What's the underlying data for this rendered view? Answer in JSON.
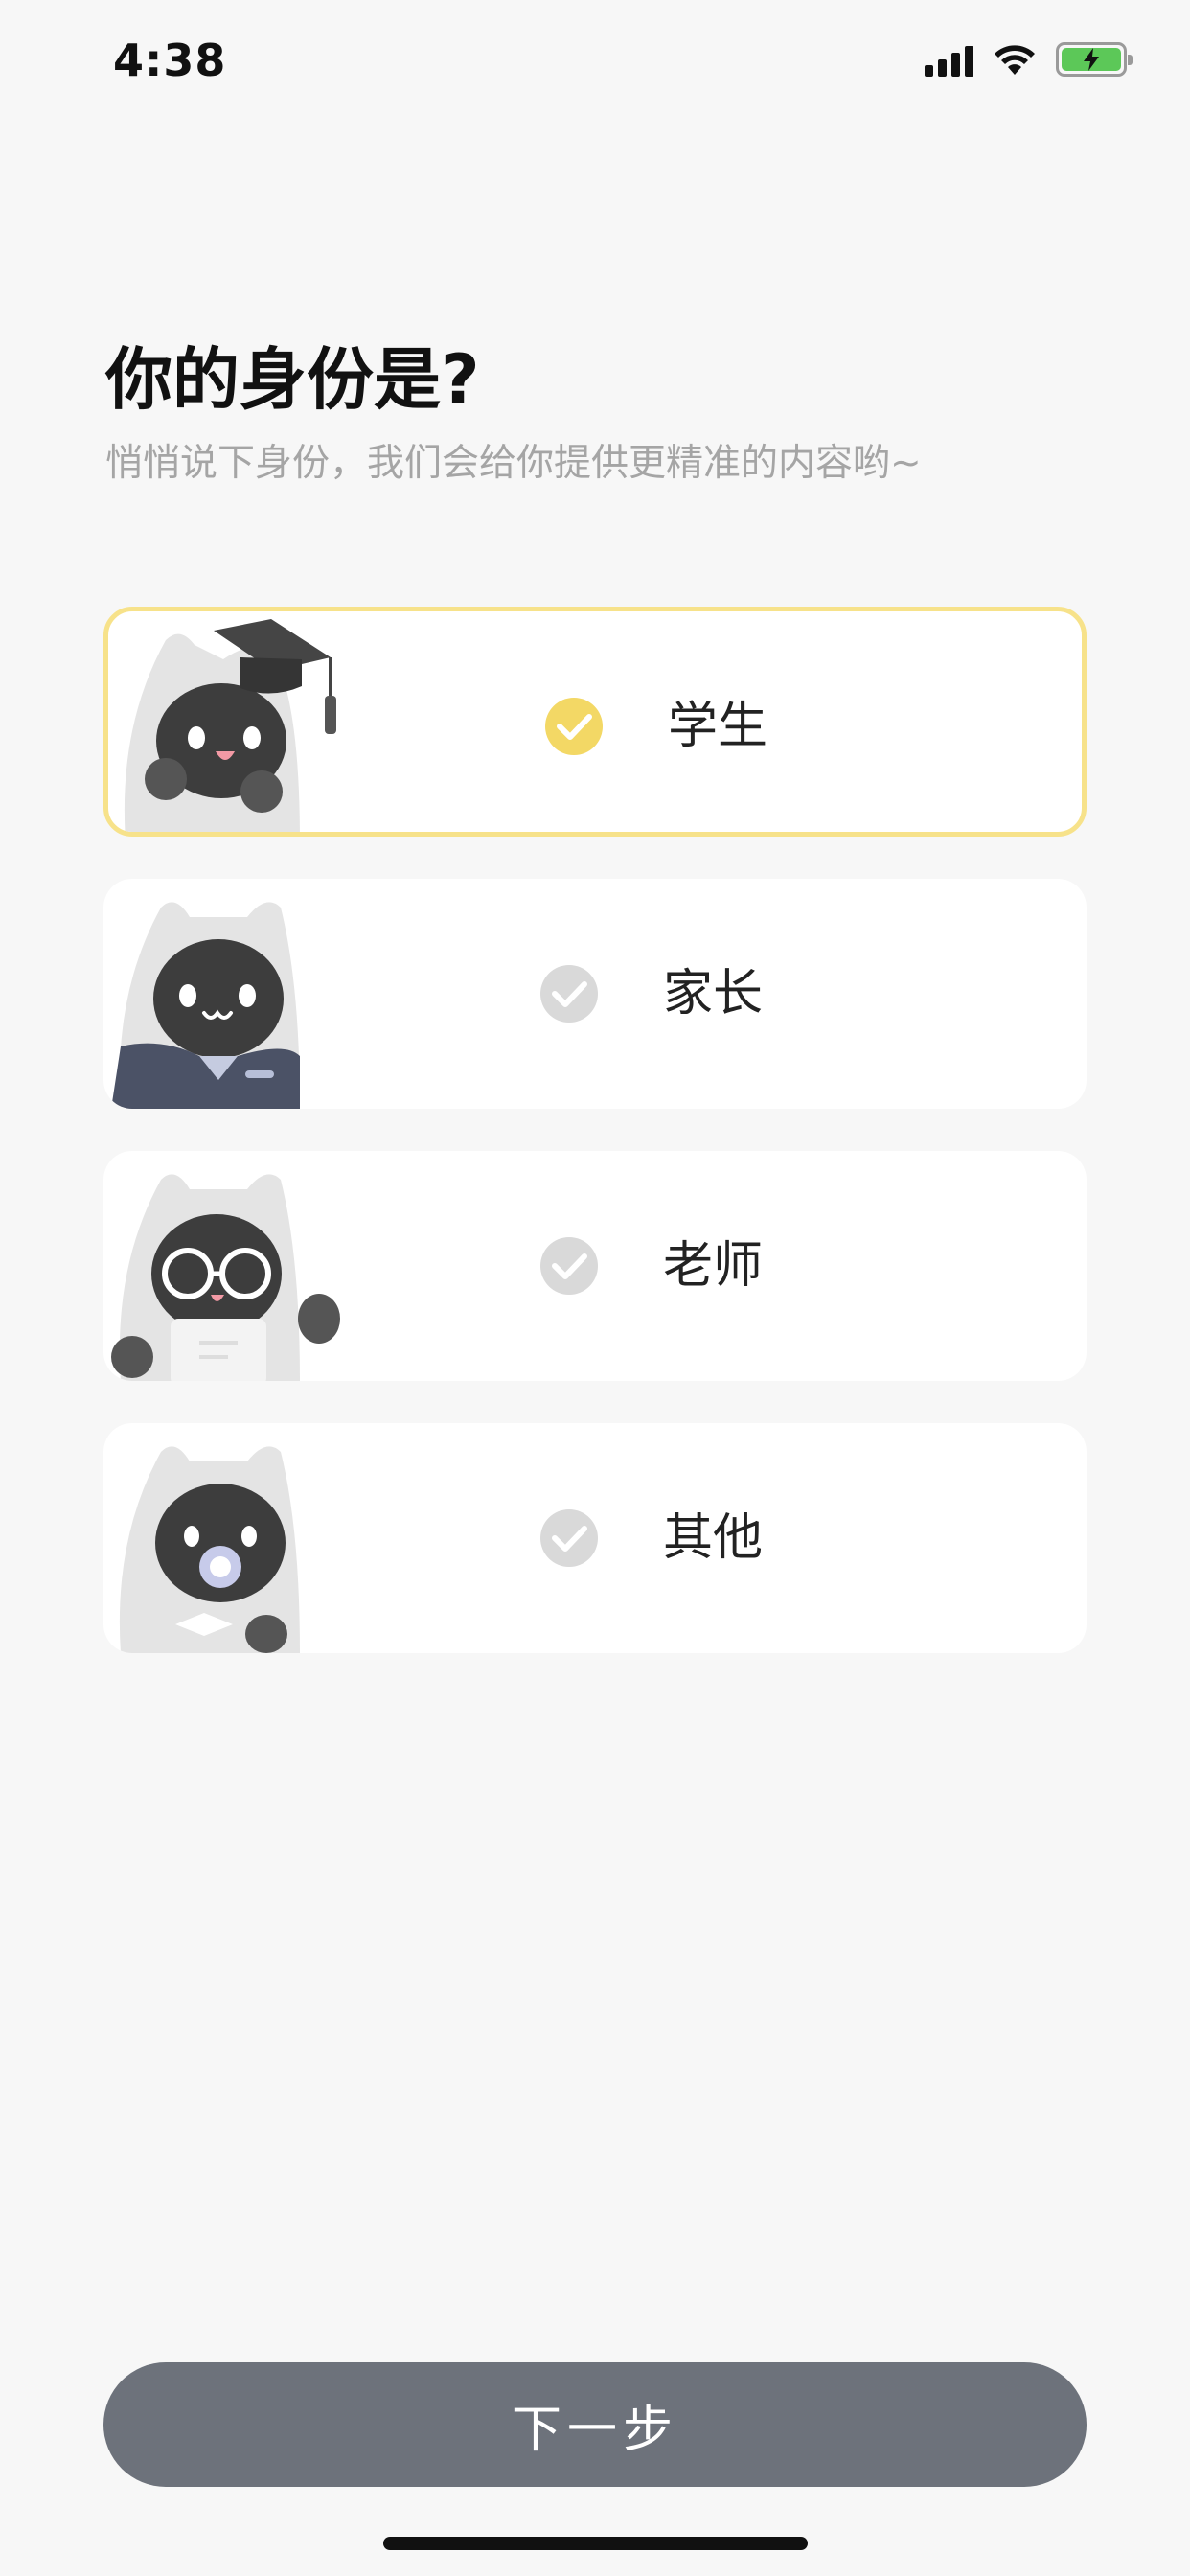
{
  "status_bar": {
    "time": "4:38",
    "icons": [
      "signal-icon",
      "wifi-icon",
      "battery-charging-icon"
    ],
    "battery_color": "#5cc858"
  },
  "header": {
    "title": "你的身份是?",
    "subtitle": "悄悄说下身份，我们会给你提供更精准的内容哟~"
  },
  "options": [
    {
      "label": "学生",
      "selected": true,
      "mascot": "graduation-cap-cat"
    },
    {
      "label": "家长",
      "selected": false,
      "mascot": "suit-cat"
    },
    {
      "label": "老师",
      "selected": false,
      "mascot": "glasses-cat"
    },
    {
      "label": "其他",
      "selected": false,
      "mascot": "pacifier-cat"
    }
  ],
  "footer": {
    "next_label": "下一步"
  },
  "colors": {
    "selected_border": "#f7e28a",
    "check_selected": "#f3d865",
    "check_unselected": "#d9d9d9",
    "button_bg": "#6d727b",
    "background": "#f7f7f7"
  }
}
